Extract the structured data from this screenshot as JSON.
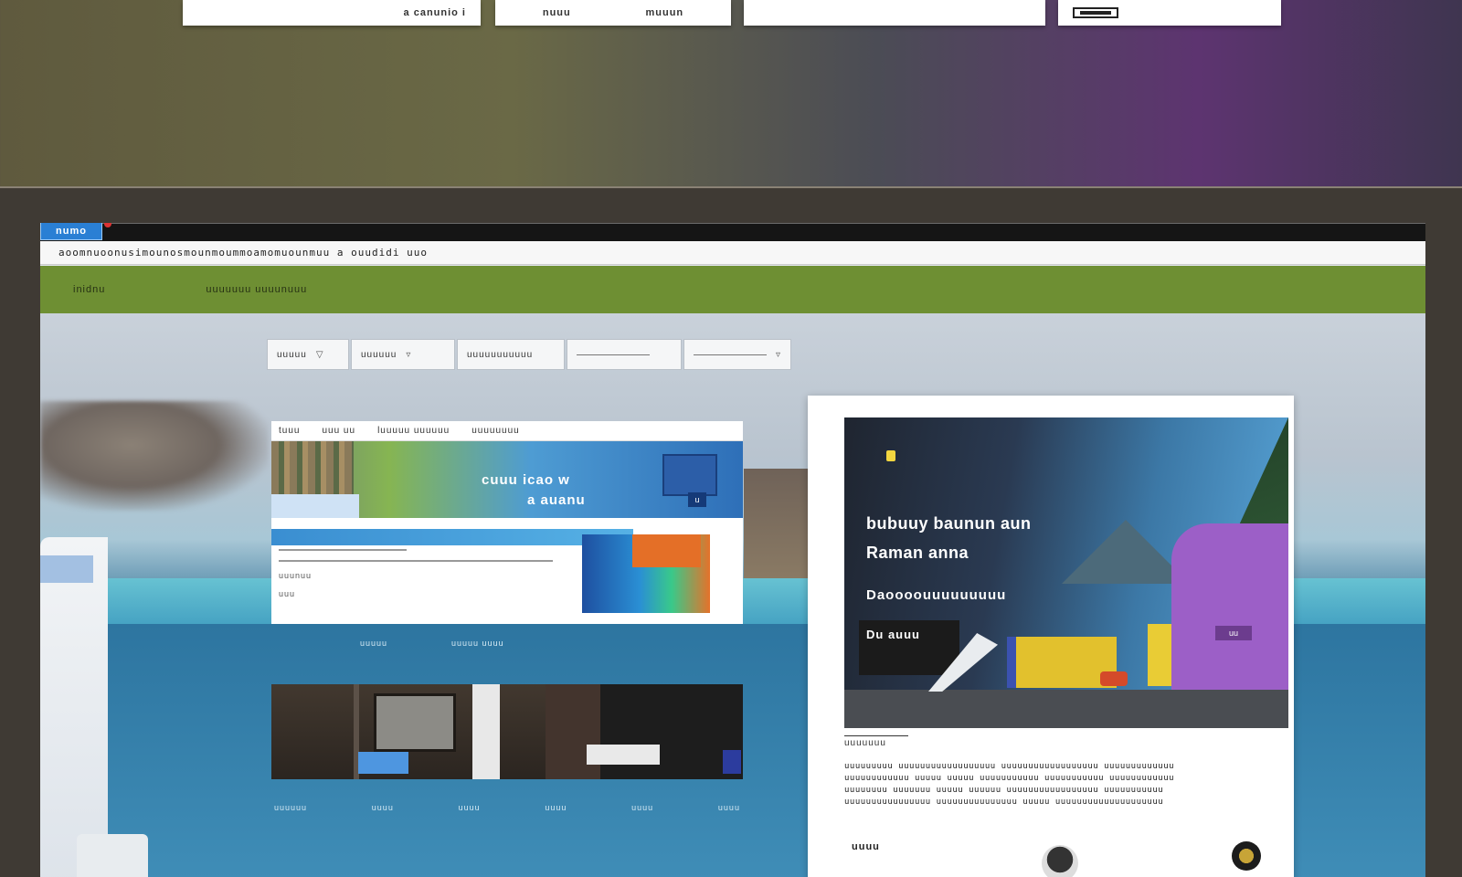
{
  "top_tiles": [
    {
      "text": "a canunio i"
    },
    {
      "text": "nuuu",
      "text2": "muuun"
    },
    {
      "text": ""
    },
    {
      "text": ""
    }
  ],
  "browser": {
    "tab_label": "numo",
    "address": "aoomnuoonusimounosmounmoummoamomuounmuu a ouudidi uuo",
    "nav": [
      "inidnu",
      "uuuuuuu uuuunuuu"
    ]
  },
  "filters": [
    {
      "label": "uuuuu",
      "caret": "▽"
    },
    {
      "label": "uuuuuu",
      "caret": "▿"
    },
    {
      "label": "uuuuuuuuuuu"
    },
    {
      "label": ""
    },
    {
      "label": "",
      "caret": "▿"
    }
  ],
  "feature_card": {
    "top_links": [
      "tuuu",
      "uuu uu",
      "luuuuu uuuuuu",
      "uuuuuuuu"
    ],
    "headline_line1": "cuuu icao w",
    "headline_line2": "a auanu",
    "mailbox_tag": "u",
    "row_labels": [
      "uuunuu",
      "uuu"
    ]
  },
  "captions": [
    "uuuuu",
    "uuuuu uuuu"
  ],
  "footer_links": [
    "uuuuuu",
    "uuuu",
    "uuuu",
    "uuuu",
    "uuuu",
    "uuuu"
  ],
  "article": {
    "headline_line1": "bubuuy baunun aun",
    "headline_line2": "Raman anna",
    "subline": "Daoooouuuuuuuuu",
    "cta": "Du auuu",
    "purple_tag": "uu",
    "meta": "uuuuuuu",
    "body": [
      "uuuuuuuuu uuuuuuuuuuuuuuuuuu uuuuuuuuuuuuuuuuuu uuuuuuuuuuuuu",
      "uuuuuuuuuuuu uuuuu uuuuu uuuuuuuuuuu uuuuuuuuuuu uuuuuuuuuuuu",
      "uuuuuuuu uuuuuuu uuuuu uuuuuu uuuuuuuuuuuuuuuuu uuuuuuuuuuu",
      "uuuuuuuuuuuuuuuu uuuuuuuuuuuuuuu uuuuu uuuuuuuuuuuuuuuuuuuu"
    ],
    "author": "uuuu"
  }
}
